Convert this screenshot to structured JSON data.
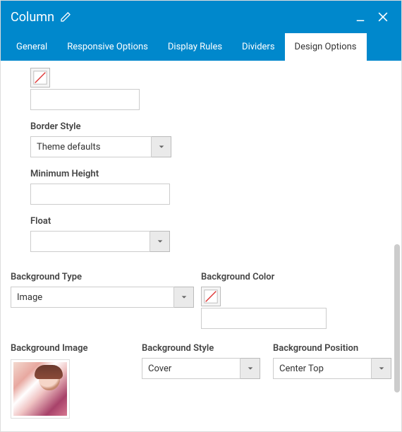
{
  "window": {
    "title": "Column"
  },
  "tabs": [
    {
      "label": "General"
    },
    {
      "label": "Responsive Options"
    },
    {
      "label": "Display Rules"
    },
    {
      "label": "Dividers"
    },
    {
      "label": "Design Options",
      "active": true
    }
  ],
  "fields": {
    "top_value": "",
    "border_style": {
      "label": "Border Style",
      "value": "Theme defaults"
    },
    "min_height": {
      "label": "Minimum Height",
      "value": ""
    },
    "float": {
      "label": "Float",
      "value": ""
    },
    "bg_type": {
      "label": "Background Type",
      "value": "Image"
    },
    "bg_color": {
      "label": "Background Color",
      "value": ""
    },
    "bg_image": {
      "label": "Background Image"
    },
    "bg_style": {
      "label": "Background Style",
      "value": "Cover"
    },
    "bg_position": {
      "label": "Background Position",
      "value": "Center Top"
    }
  },
  "icons": {
    "none_color": "no-color"
  }
}
